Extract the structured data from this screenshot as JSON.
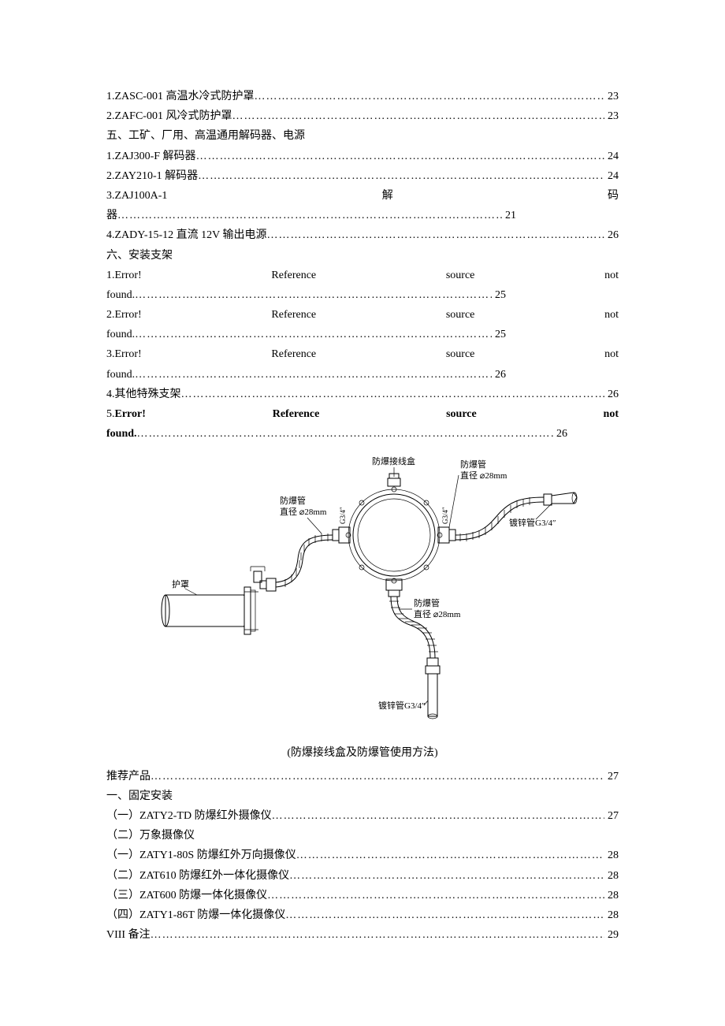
{
  "toc1": [
    {
      "label": "1.ZASC-001 高温水冷式防护罩",
      "page": "23"
    },
    {
      "label": "2.ZAFC-001 风冷式防护罩",
      "page": "23"
    }
  ],
  "section5": "五、工矿、厂用、高温通用解码器、电源",
  "toc2": [
    {
      "label": "1.ZAJ300-F 解码器",
      "page": "24"
    },
    {
      "label": "2.ZAY210-1 解码器",
      "page": "24"
    }
  ],
  "item3": {
    "line1": {
      "a": "3.ZAJ100A-1",
      "b": "解",
      "c": "码"
    },
    "line2": {
      "label": "器",
      "page": "21"
    }
  },
  "toc3": [
    {
      "label": "4.ZADY-15-12 直流 12V 输出电源",
      "page": "26"
    }
  ],
  "section6": "六、安装支架",
  "errs": {
    "w1": "Error!",
    "w2": "Reference",
    "w3": "source",
    "w4": "not",
    "prefix1": "1.",
    "prefix2": "2.",
    "prefix3": "3.",
    "prefix5": "5.",
    "found": "found.",
    "p25a": "25",
    "p25b": "25",
    "p26a": "26",
    "p26c": "26"
  },
  "toc4": [
    {
      "label": "4.其他特殊支架",
      "page": "26"
    }
  ],
  "diagram": {
    "topbox": "防爆接线盒",
    "pipe_label_l1": "防爆管",
    "pipe_label_l2": "直径 ⌀28mm",
    "galv_pipe": "镀锌管G3/4″",
    "shroud": "护罩",
    "g34": "G3/4″"
  },
  "fig_caption": "(防爆接线盒及防爆管使用方法)",
  "toc5": [
    {
      "label": "推荐产品",
      "page": "27"
    }
  ],
  "sectionFix": "一、固定安装",
  "toc6": [
    {
      "label": "（一）ZATY2-TD 防爆红外摄像仪",
      "page": "27"
    }
  ],
  "sectionWan": "（二）万象摄像仪",
  "toc7": [
    {
      "label": "（一）ZATY1-80S 防爆红外万向摄像仪",
      "page": "28"
    },
    {
      "label": "（二）ZAT610 防爆红外一体化摄像仪",
      "page": "28"
    },
    {
      "label": "（三）ZAT600 防爆一体化摄像仪",
      "page": "28"
    },
    {
      "label": "（四）ZATY1-86T 防爆一体化摄像仪",
      "page": "28"
    },
    {
      "label": "VIII 备注",
      "page": "29"
    }
  ],
  "leader": "………………………………………………………………………………………………………………………………………………………………"
}
